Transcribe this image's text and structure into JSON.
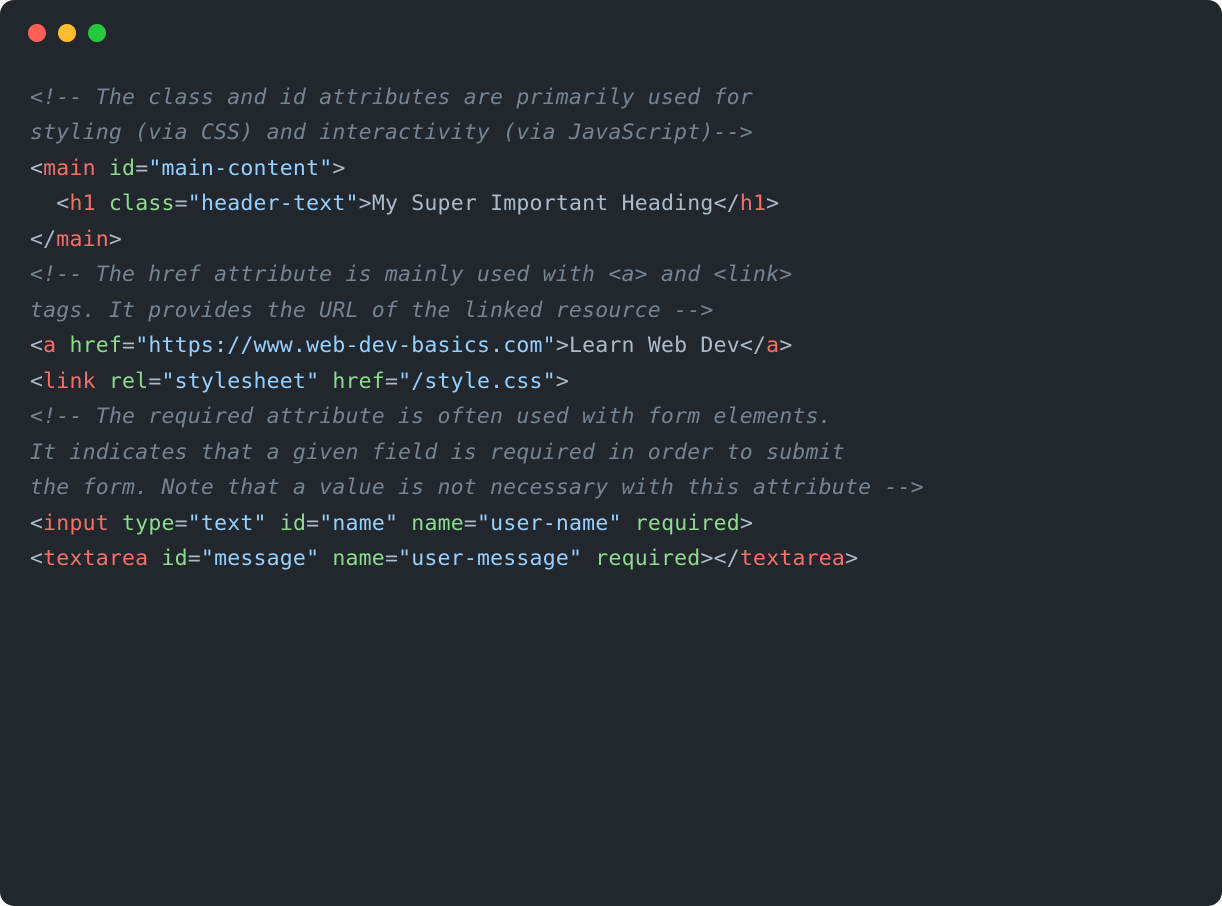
{
  "titlebar": {
    "buttons": [
      "close",
      "minimize",
      "maximize"
    ]
  },
  "code": {
    "line1": "<!-- The class and id attributes are primarily used for",
    "line2": "styling (via CSS) and interactivity (via JavaScript)-->",
    "blank1": "",
    "line3": {
      "open_bracket": "<",
      "tag": "main",
      "sp1": " ",
      "attr": "id",
      "eq": "=",
      "val": "\"main-content\"",
      "close_bracket": ">"
    },
    "line4": {
      "indent": "  ",
      "open_bracket": "<",
      "tag": "h1",
      "sp1": " ",
      "attr": "class",
      "eq": "=",
      "val": "\"header-text\"",
      "close_bracket": ">",
      "text": "My Super Important Heading",
      "open_close": "</",
      "tag2": "h1",
      "close2": ">"
    },
    "line5": {
      "open_close": "</",
      "tag": "main",
      "close": ">"
    },
    "blank2": "",
    "line6": "<!-- The href attribute is mainly used with <a> and <link>",
    "line7": "tags. It provides the URL of the linked resource -->",
    "blank3": "",
    "line8": {
      "open_bracket": "<",
      "tag": "a",
      "sp1": " ",
      "attr": "href",
      "eq": "=",
      "val": "\"https://www.web-dev-basics.com\"",
      "close_bracket": ">",
      "text": "Learn Web Dev",
      "open_close": "</",
      "tag2": "a",
      "close2": ">"
    },
    "blank4": "",
    "line9": {
      "open_bracket": "<",
      "tag": "link",
      "sp1": " ",
      "attr1": "rel",
      "eq1": "=",
      "val1": "\"stylesheet\"",
      "sp2": " ",
      "attr2": "href",
      "eq2": "=",
      "val2": "\"/style.css\"",
      "close_bracket": ">"
    },
    "blank5": "",
    "line10": "<!-- The required attribute is often used with form elements.",
    "line11": "It indicates that a given field is required in order to submit",
    "line12": "the form. Note that a value is not necessary with this attribute -->",
    "blank6": "",
    "line13": {
      "open_bracket": "<",
      "tag": "input",
      "sp1": " ",
      "attr1": "type",
      "eq1": "=",
      "val1": "\"text\"",
      "sp2": " ",
      "attr2": "id",
      "eq2": "=",
      "val2": "\"name\"",
      "sp3": " ",
      "attr3": "name",
      "eq3": "=",
      "val3": "\"user-name\"",
      "sp4": " ",
      "attr4": "required",
      "close_bracket": ">"
    },
    "blank7": "",
    "line14": {
      "open_bracket": "<",
      "tag": "textarea",
      "sp1": " ",
      "attr1": "id",
      "eq1": "=",
      "val1": "\"message\"",
      "sp2": " ",
      "attr2": "name",
      "eq2": "=",
      "val2": "\"user-message\"",
      "sp3": " ",
      "attr3": "required",
      "close_bracket": ">",
      "open_close": "</",
      "tag2": "textarea",
      "close2": ">"
    }
  }
}
